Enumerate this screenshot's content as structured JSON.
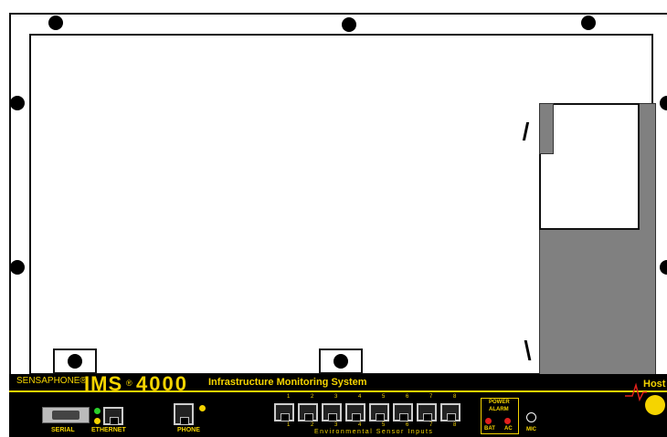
{
  "brand": {
    "company": "SENSAPHONE®",
    "model_prefix": "IMS",
    "model_mid": "®",
    "model_number": "4000",
    "tagline": "Infrastructure Monitoring System",
    "host_label": "Host"
  },
  "ports": {
    "serial_label": "SERIAL",
    "ethernet_label": "ETHERNET",
    "phone_label": "PHONE",
    "sensor_numbers_top": [
      "1",
      "2",
      "3",
      "4",
      "5",
      "6",
      "7",
      "8"
    ],
    "sensor_numbers_bottom": [
      "1",
      "2",
      "3",
      "4",
      "5",
      "6",
      "7",
      "8"
    ],
    "sensor_caption": "Environmental Sensor Inputs"
  },
  "power_alarm": {
    "title_line1": "POWER",
    "title_line2": "ALARM",
    "bat_label": "BAT",
    "ac_label": "AC"
  },
  "mic_label": "MIC",
  "colors": {
    "accent_yellow": "#f5d400",
    "led_red": "#e0201b",
    "led_green": "#2bd02b",
    "bracket_gray": "#808080"
  }
}
